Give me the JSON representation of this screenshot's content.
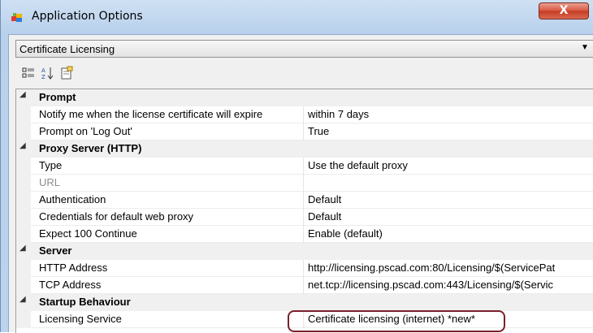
{
  "window": {
    "title": "Application Options",
    "close_label": "X"
  },
  "category_selector": {
    "selected": "Certificate Licensing"
  },
  "toolbar": {
    "icons": [
      "categorized-icon",
      "alphabetical-sort-icon",
      "property-pages-icon"
    ]
  },
  "grid": {
    "categories": [
      {
        "label": "Prompt",
        "properties": [
          {
            "name": "Notify me when the license certificate will expire",
            "value": "within 7 days"
          },
          {
            "name": "Prompt on 'Log Out'",
            "value": "True"
          }
        ]
      },
      {
        "label": "Proxy Server (HTTP)",
        "properties": [
          {
            "name": "Type",
            "value": "Use the default proxy"
          },
          {
            "name": "URL",
            "value": "",
            "disabled": true
          },
          {
            "name": "Authentication",
            "value": "Default"
          },
          {
            "name": "Credentials for default web proxy",
            "value": "Default"
          },
          {
            "name": "Expect 100 Continue",
            "value": "Enable (default)"
          }
        ]
      },
      {
        "label": "Server",
        "properties": [
          {
            "name": "HTTP Address",
            "value": "http://licensing.pscad.com:80/Licensing/$(ServicePat"
          },
          {
            "name": "TCP Address",
            "value": "net.tcp://licensing.pscad.com:443/Licensing/$(Servic"
          }
        ]
      },
      {
        "label": "Startup Behaviour",
        "properties": [
          {
            "name": "Licensing Service",
            "value": "Certificate licensing (internet) *new*"
          }
        ]
      }
    ]
  },
  "colors": {
    "highlight_outline": "#7b1f2b",
    "close_button": "#c43a22"
  }
}
